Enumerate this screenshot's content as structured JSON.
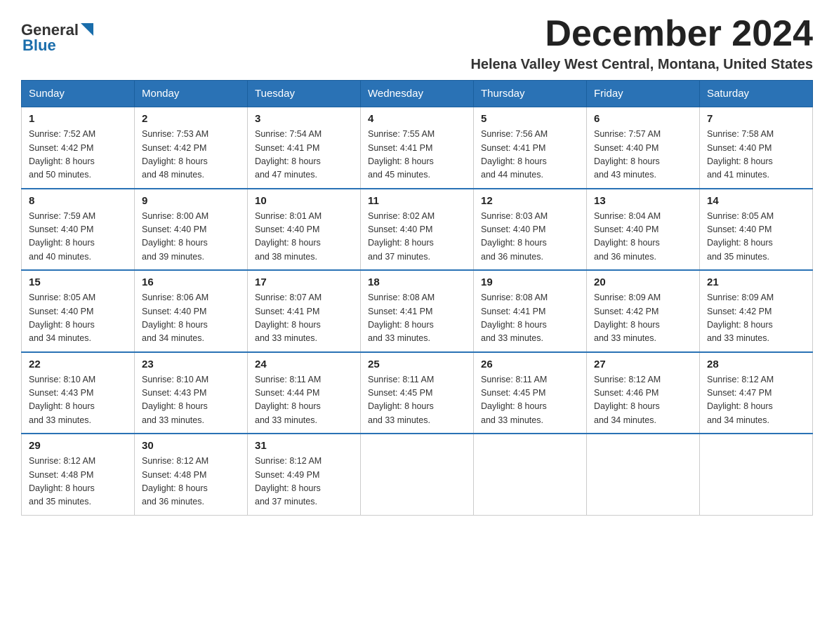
{
  "header": {
    "logo_general": "General",
    "logo_blue": "Blue",
    "title": "December 2024",
    "subtitle": "Helena Valley West Central, Montana, United States"
  },
  "days_of_week": [
    "Sunday",
    "Monday",
    "Tuesday",
    "Wednesday",
    "Thursday",
    "Friday",
    "Saturday"
  ],
  "weeks": [
    [
      {
        "day": "1",
        "sunrise": "7:52 AM",
        "sunset": "4:42 PM",
        "daylight": "8 hours and 50 minutes."
      },
      {
        "day": "2",
        "sunrise": "7:53 AM",
        "sunset": "4:42 PM",
        "daylight": "8 hours and 48 minutes."
      },
      {
        "day": "3",
        "sunrise": "7:54 AM",
        "sunset": "4:41 PM",
        "daylight": "8 hours and 47 minutes."
      },
      {
        "day": "4",
        "sunrise": "7:55 AM",
        "sunset": "4:41 PM",
        "daylight": "8 hours and 45 minutes."
      },
      {
        "day": "5",
        "sunrise": "7:56 AM",
        "sunset": "4:41 PM",
        "daylight": "8 hours and 44 minutes."
      },
      {
        "day": "6",
        "sunrise": "7:57 AM",
        "sunset": "4:40 PM",
        "daylight": "8 hours and 43 minutes."
      },
      {
        "day": "7",
        "sunrise": "7:58 AM",
        "sunset": "4:40 PM",
        "daylight": "8 hours and 41 minutes."
      }
    ],
    [
      {
        "day": "8",
        "sunrise": "7:59 AM",
        "sunset": "4:40 PM",
        "daylight": "8 hours and 40 minutes."
      },
      {
        "day": "9",
        "sunrise": "8:00 AM",
        "sunset": "4:40 PM",
        "daylight": "8 hours and 39 minutes."
      },
      {
        "day": "10",
        "sunrise": "8:01 AM",
        "sunset": "4:40 PM",
        "daylight": "8 hours and 38 minutes."
      },
      {
        "day": "11",
        "sunrise": "8:02 AM",
        "sunset": "4:40 PM",
        "daylight": "8 hours and 37 minutes."
      },
      {
        "day": "12",
        "sunrise": "8:03 AM",
        "sunset": "4:40 PM",
        "daylight": "8 hours and 36 minutes."
      },
      {
        "day": "13",
        "sunrise": "8:04 AM",
        "sunset": "4:40 PM",
        "daylight": "8 hours and 36 minutes."
      },
      {
        "day": "14",
        "sunrise": "8:05 AM",
        "sunset": "4:40 PM",
        "daylight": "8 hours and 35 minutes."
      }
    ],
    [
      {
        "day": "15",
        "sunrise": "8:05 AM",
        "sunset": "4:40 PM",
        "daylight": "8 hours and 34 minutes."
      },
      {
        "day": "16",
        "sunrise": "8:06 AM",
        "sunset": "4:40 PM",
        "daylight": "8 hours and 34 minutes."
      },
      {
        "day": "17",
        "sunrise": "8:07 AM",
        "sunset": "4:41 PM",
        "daylight": "8 hours and 33 minutes."
      },
      {
        "day": "18",
        "sunrise": "8:08 AM",
        "sunset": "4:41 PM",
        "daylight": "8 hours and 33 minutes."
      },
      {
        "day": "19",
        "sunrise": "8:08 AM",
        "sunset": "4:41 PM",
        "daylight": "8 hours and 33 minutes."
      },
      {
        "day": "20",
        "sunrise": "8:09 AM",
        "sunset": "4:42 PM",
        "daylight": "8 hours and 33 minutes."
      },
      {
        "day": "21",
        "sunrise": "8:09 AM",
        "sunset": "4:42 PM",
        "daylight": "8 hours and 33 minutes."
      }
    ],
    [
      {
        "day": "22",
        "sunrise": "8:10 AM",
        "sunset": "4:43 PM",
        "daylight": "8 hours and 33 minutes."
      },
      {
        "day": "23",
        "sunrise": "8:10 AM",
        "sunset": "4:43 PM",
        "daylight": "8 hours and 33 minutes."
      },
      {
        "day": "24",
        "sunrise": "8:11 AM",
        "sunset": "4:44 PM",
        "daylight": "8 hours and 33 minutes."
      },
      {
        "day": "25",
        "sunrise": "8:11 AM",
        "sunset": "4:45 PM",
        "daylight": "8 hours and 33 minutes."
      },
      {
        "day": "26",
        "sunrise": "8:11 AM",
        "sunset": "4:45 PM",
        "daylight": "8 hours and 33 minutes."
      },
      {
        "day": "27",
        "sunrise": "8:12 AM",
        "sunset": "4:46 PM",
        "daylight": "8 hours and 34 minutes."
      },
      {
        "day": "28",
        "sunrise": "8:12 AM",
        "sunset": "4:47 PM",
        "daylight": "8 hours and 34 minutes."
      }
    ],
    [
      {
        "day": "29",
        "sunrise": "8:12 AM",
        "sunset": "4:48 PM",
        "daylight": "8 hours and 35 minutes."
      },
      {
        "day": "30",
        "sunrise": "8:12 AM",
        "sunset": "4:48 PM",
        "daylight": "8 hours and 36 minutes."
      },
      {
        "day": "31",
        "sunrise": "8:12 AM",
        "sunset": "4:49 PM",
        "daylight": "8 hours and 37 minutes."
      },
      null,
      null,
      null,
      null
    ]
  ],
  "labels": {
    "sunrise": "Sunrise:",
    "sunset": "Sunset:",
    "daylight": "Daylight:"
  }
}
